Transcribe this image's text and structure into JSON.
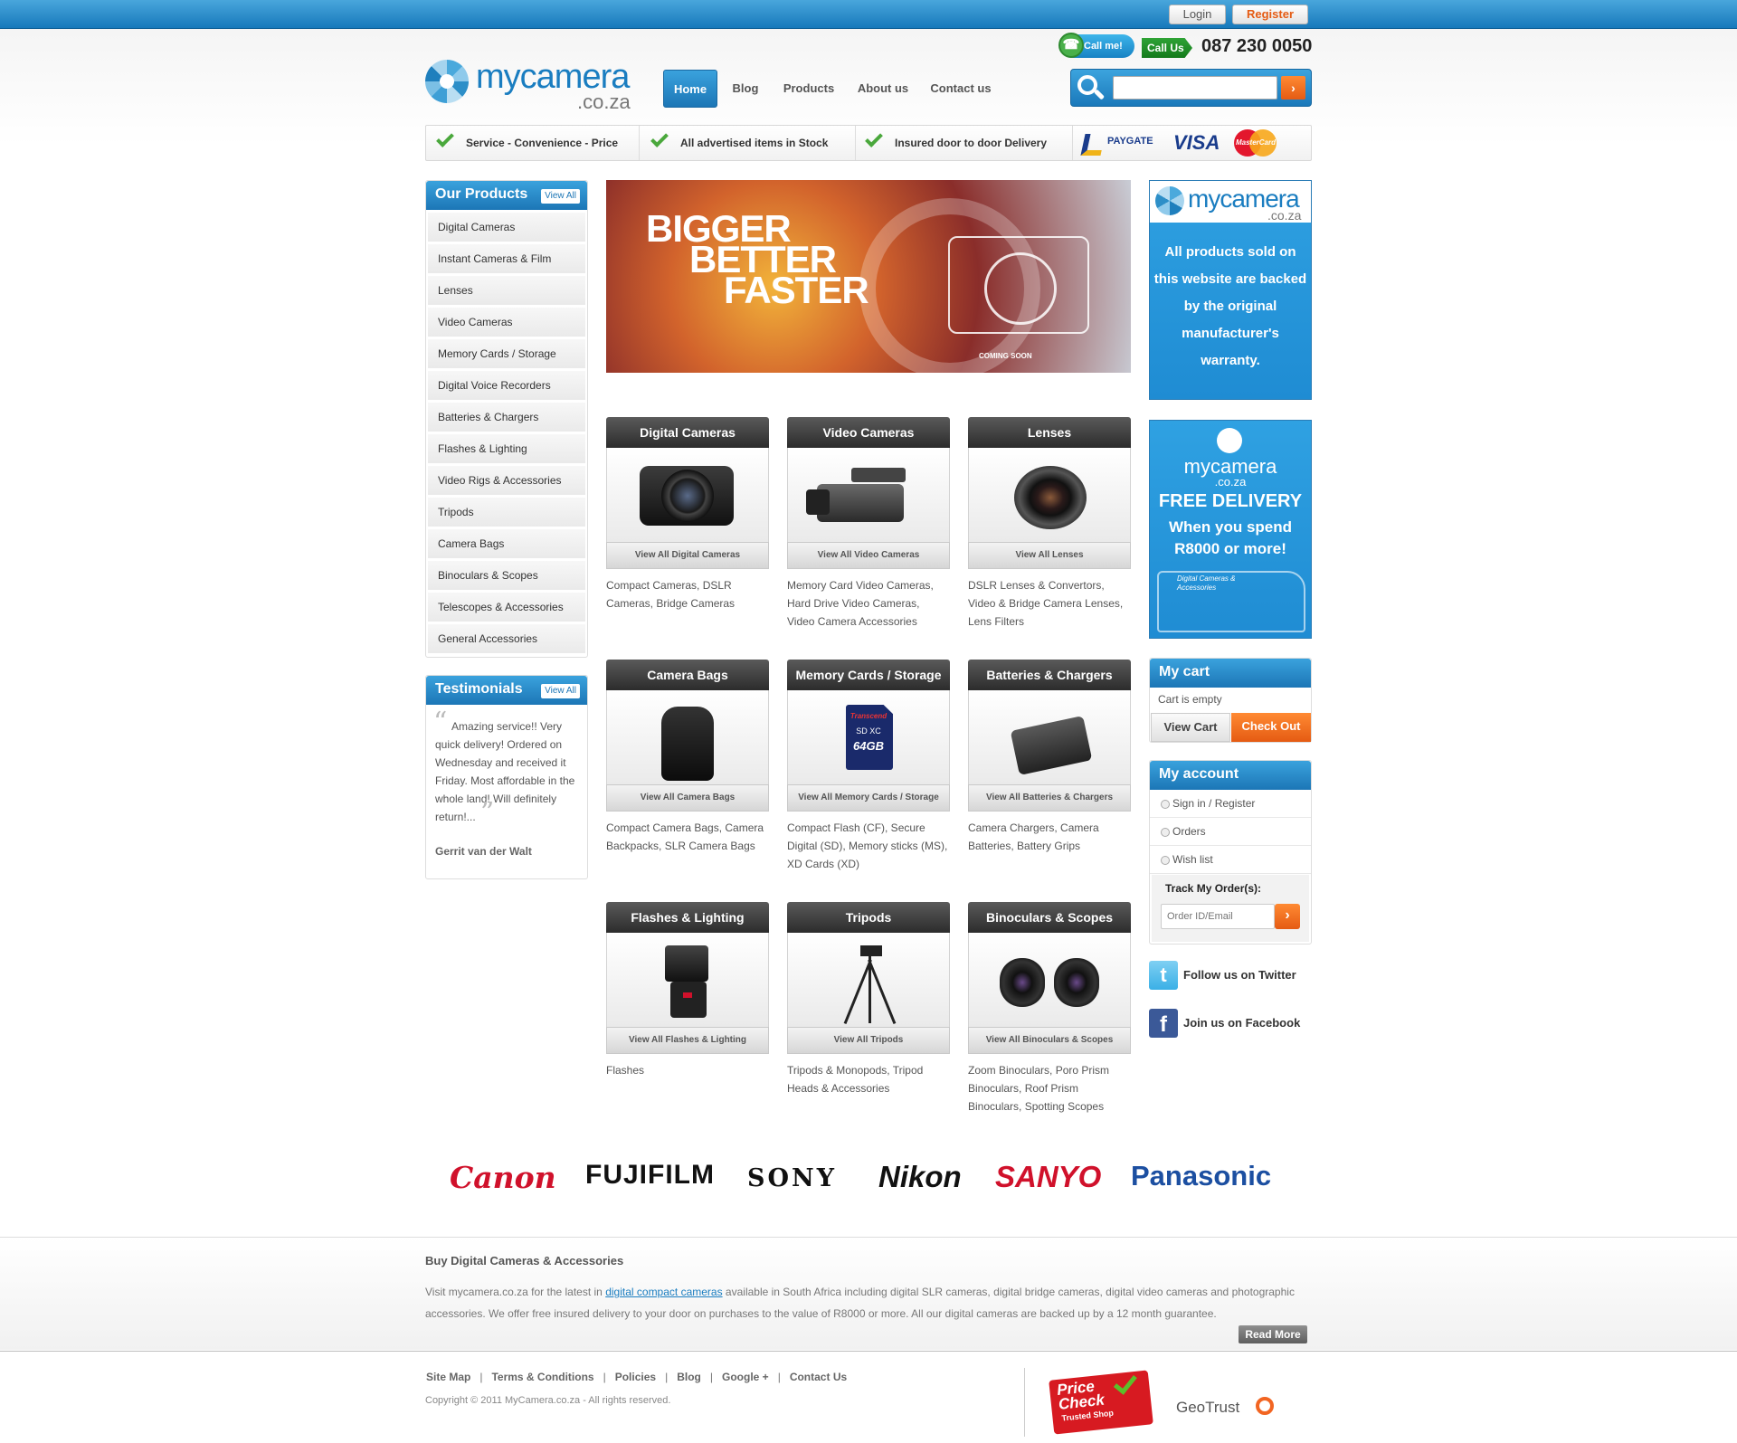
{
  "topbar": {
    "login": "Login",
    "register": "Register"
  },
  "header": {
    "logo_main": "mycamera",
    "logo_sub": ".co.za",
    "call_me": "Call me!",
    "call_us": "Call Us",
    "phone": "087 230 0050",
    "nav": [
      "Home",
      "Blog",
      "Products",
      "About us",
      "Contact us"
    ],
    "search_placeholder": ""
  },
  "trust": {
    "items": [
      "Service - Convenience - Price",
      "All advertised items in Stock",
      "Insured door to door Delivery"
    ],
    "paygate": "PAYGATE",
    "visa": "VISA",
    "mastercard": "MasterCard"
  },
  "products_box": {
    "title": "Our Products",
    "view_all": "View All",
    "items": [
      "Digital Cameras",
      "Instant Cameras & Film",
      "Lenses",
      "Video Cameras",
      "Memory Cards / Storage",
      "Digital Voice Recorders",
      "Batteries & Chargers",
      "Flashes & Lighting",
      "Video Rigs & Accessories",
      "Tripods",
      "Camera Bags",
      "Binoculars & Scopes",
      "Telescopes & Accessories",
      "General Accessories"
    ]
  },
  "testimonials": {
    "title": "Testimonials",
    "view_all": "View All",
    "quote": "Amazing service!! Very quick delivery! Ordered on Wednesday and received it Friday. Most affordable in the whole land! Will definitely return!...",
    "author": "Gerrit van der Walt"
  },
  "banner": {
    "line1": "BIGGER",
    "line2": "BETTER",
    "line3": "FASTER",
    "note": "COMING SOON"
  },
  "tiles": [
    {
      "title": "Digital Cameras",
      "link": "View All Digital Cameras",
      "desc": "Compact Cameras, DSLR Cameras, Bridge Cameras",
      "icon": "dslr-camera-icon"
    },
    {
      "title": "Video Cameras",
      "link": "View All Video Cameras",
      "desc": "Memory Card Video Cameras, Hard Drive Video Cameras, Video Camera Accessories",
      "icon": "video-camera-icon"
    },
    {
      "title": "Lenses",
      "link": "View All Lenses",
      "desc": "DSLR Lenses & Convertors, Video & Bridge Camera Lenses, Lens Filters",
      "icon": "lens-icon"
    },
    {
      "title": "Camera Bags",
      "link": "View All Camera Bags",
      "desc": "Compact Camera Bags, Camera Backpacks, SLR Camera Bags",
      "icon": "camera-bag-icon"
    },
    {
      "title": "Memory Cards / Storage",
      "link": "View All Memory Cards / Storage",
      "desc": "Compact Flash (CF), Secure Digital (SD), Memory sticks (MS), XD Cards (XD)",
      "icon": "sd-card-icon",
      "card_brand": "Transcend",
      "card_size": "64GB",
      "card_type": "SD XC"
    },
    {
      "title": "Batteries & Chargers",
      "link": "View All Batteries & Chargers",
      "desc": "Camera Chargers, Camera Batteries, Battery Grips",
      "icon": "battery-icon"
    },
    {
      "title": "Flashes & Lighting",
      "link": "View All Flashes & Lighting",
      "desc": "Flashes",
      "icon": "flash-icon"
    },
    {
      "title": "Tripods",
      "link": "View All Tripods",
      "desc": "Tripods & Monopods, Tripod Heads & Accessories",
      "icon": "tripod-icon"
    },
    {
      "title": "Binoculars & Scopes",
      "link": "View All Binoculars & Scopes",
      "desc": "Zoom Binoculars, Poro Prism Binoculars, Roof Prism Binoculars, Spotting Scopes",
      "icon": "binoculars-icon"
    }
  ],
  "warranty_ad": {
    "logo_main": "mycamera",
    "logo_sub": ".co.za",
    "text": "All products sold on this website are backed by the original manufacturer's warranty."
  },
  "delivery_ad": {
    "logo_main": "mycamera",
    "logo_sub": ".co.za",
    "headline": "FREE DELIVERY",
    "text": "When you spend R8000 or more!",
    "van_text": "Digital Cameras & Accessories"
  },
  "cart": {
    "title": "My cart",
    "status": "Cart is empty",
    "view": "View Cart",
    "checkout": "Check Out"
  },
  "account": {
    "title": "My account",
    "items": [
      "Sign in / Register",
      "Orders",
      "Wish list"
    ],
    "track_label": "Track My Order(s):",
    "track_placeholder": "Order ID/Email"
  },
  "social": {
    "twitter": "Follow us on Twitter",
    "facebook": "Join us on Facebook"
  },
  "brands": [
    "Canon",
    "FUJIFILM",
    "SONY",
    "Nikon",
    "SANYO",
    "Panasonic"
  ],
  "seo": {
    "title": "Buy Digital Cameras & Accessories",
    "text_before": "Visit mycamera.co.za for the latest in ",
    "link": "digital compact cameras",
    "text_after": " available in South Africa including digital SLR cameras, digital bridge cameras, digital video cameras and photographic accessories. We offer free insured delivery to your door on purchases to the value of R8000 or more. All our digital cameras are backed up by a 12 month guarantee.",
    "read_more": "Read More"
  },
  "footer": {
    "links": [
      "Site Map",
      "Terms & Conditions",
      "Policies",
      "Blog",
      "Google +",
      "Contact Us"
    ],
    "copyright": "Copyright © 2011 MyCamera.co.za - All rights reserved.",
    "pricecheck_line1": "Price",
    "pricecheck_line2": "Check",
    "pricecheck_line3": "Trusted Shop",
    "geotrust": "GeoTrust"
  }
}
